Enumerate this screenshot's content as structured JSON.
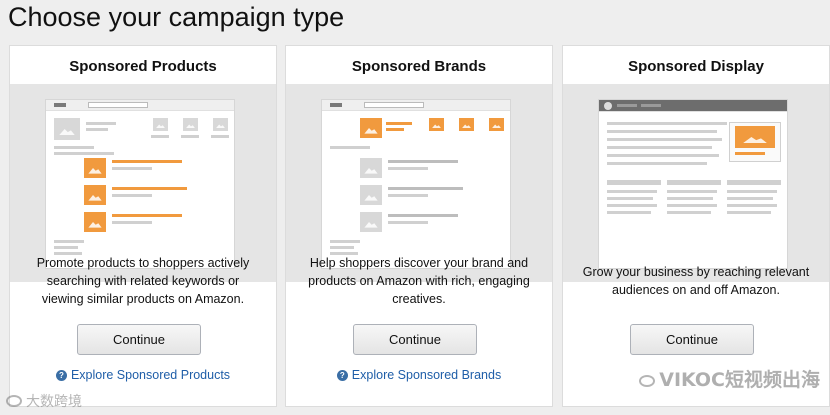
{
  "page": {
    "title": "Choose your campaign type"
  },
  "cards": [
    {
      "title": "Sponsored Products",
      "description_lines": [
        "Promote products to shoppers actively",
        "searching with related keywords or",
        "viewing similar products on Amazon."
      ],
      "button_label": "Continue",
      "explore_label": "Explore Sponsored Products"
    },
    {
      "title": "Sponsored Brands",
      "description_lines": [
        "Help shoppers discover your brand and",
        "products on Amazon with rich, engaging",
        "creatives."
      ],
      "button_label": "Continue",
      "explore_label": "Explore Sponsored Brands"
    },
    {
      "title": "Sponsored Display",
      "description_lines": [
        "Grow your business by reaching relevant",
        "audiences on and off Amazon."
      ],
      "button_label": "Continue",
      "explore_label": ""
    }
  ],
  "watermarks": {
    "left": "大数跨境",
    "right": "VIKOC短视频出海"
  },
  "colors": {
    "accent": "#f19a3e",
    "link": "#1f5ea8",
    "background": "#eeeeee"
  }
}
